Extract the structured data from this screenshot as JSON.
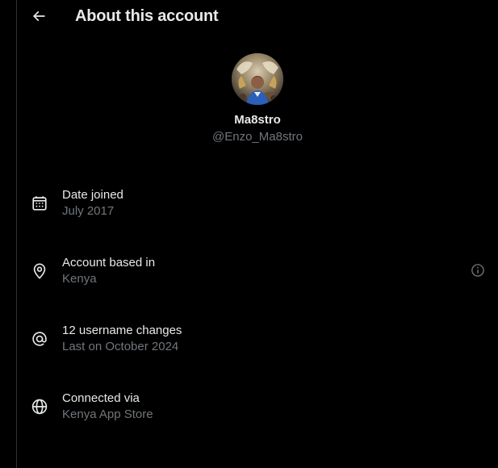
{
  "header": {
    "title": "About this account",
    "back_icon": "arrow-left-icon"
  },
  "profile": {
    "display_name": "Ma8stro",
    "handle": "@Enzo_Ma8stro",
    "avatar_icon": "avatar"
  },
  "info": [
    {
      "icon": "calendar-icon",
      "label": "Date joined",
      "value": "July 2017"
    },
    {
      "icon": "location-pin-icon",
      "label": "Account based in",
      "value": "Kenya"
    },
    {
      "icon": "at-sign-icon",
      "label": "12 username changes",
      "value": "Last on October 2024"
    },
    {
      "icon": "globe-icon",
      "label": "Connected via",
      "value": "Kenya App Store"
    }
  ],
  "colors": {
    "background": "#000000",
    "primary_text": "#e7e9ea",
    "secondary_text": "#71767b",
    "border": "#2f3336"
  }
}
